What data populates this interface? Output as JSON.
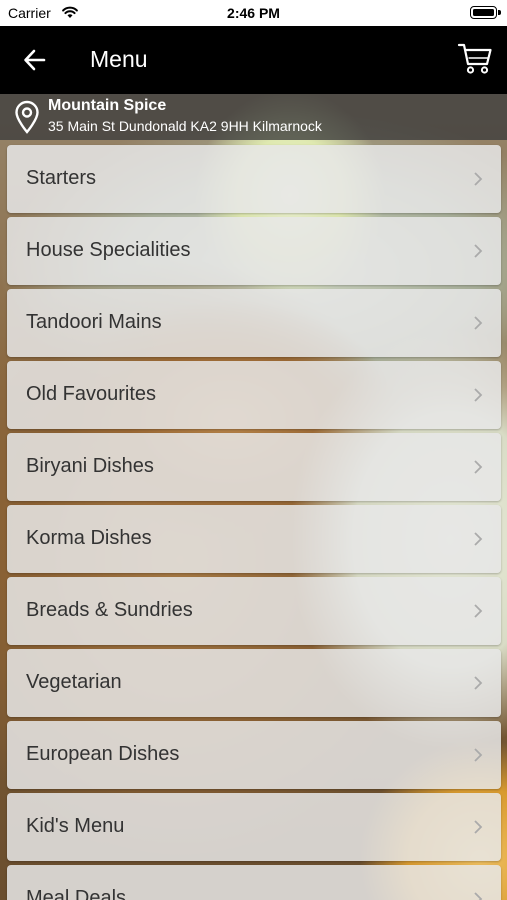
{
  "status_bar": {
    "carrier": "Carrier",
    "time": "2:46 PM"
  },
  "nav": {
    "title": "Menu",
    "back_icon": "back-arrow-icon",
    "cart_icon": "shopping-cart-icon"
  },
  "location": {
    "icon": "map-pin-icon",
    "name": "Mountain Spice",
    "address": "35 Main St Dundonald KA2 9HH Kilmarnock"
  },
  "menu": {
    "items": [
      {
        "label": "Starters"
      },
      {
        "label": "House Specialities"
      },
      {
        "label": "Tandoori Mains"
      },
      {
        "label": "Old Favourites"
      },
      {
        "label": "Biryani Dishes"
      },
      {
        "label": "Korma Dishes"
      },
      {
        "label": "Breads & Sundries"
      },
      {
        "label": "Vegetarian"
      },
      {
        "label": "European Dishes"
      },
      {
        "label": "Kid's Menu"
      },
      {
        "label": "Meal Deals"
      }
    ]
  },
  "colors": {
    "nav_background": "#000000",
    "item_background": "#e6e6e6",
    "item_text": "#333333"
  }
}
